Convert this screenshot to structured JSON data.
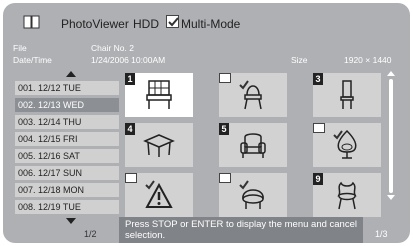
{
  "header": {
    "app_title": "PhotoViewer",
    "source": "HDD",
    "multi_mode_label": "Multi-Mode",
    "multi_mode_checked": true
  },
  "info": {
    "file_label": "File",
    "file_value": "Chair No. 2",
    "datetime_label": "Date/Time",
    "datetime_value": "1/24/2006 10:00AM",
    "size_label": "Size",
    "size_value": "1920 × 1440"
  },
  "dates": {
    "items": [
      {
        "label": "001. 12/12 TUE"
      },
      {
        "label": "002. 12/13 WED"
      },
      {
        "label": "003. 12/14 THU"
      },
      {
        "label": "004. 12/15 FRI"
      },
      {
        "label": "005. 12/16 SAT"
      },
      {
        "label": "006. 12/17 SUN"
      },
      {
        "label": "007. 12/18 MON"
      },
      {
        "label": "008. 12/19 TUE"
      }
    ],
    "selected_index": 1,
    "page": "1/2"
  },
  "thumbnails": {
    "items": [
      {
        "number": "1",
        "icon": "grid-chair-icon",
        "checked": false,
        "selected": true
      },
      {
        "number": "",
        "icon": "chair-icon",
        "checked": true,
        "selected": false
      },
      {
        "number": "3",
        "icon": "tall-chair-icon",
        "checked": false,
        "selected": false
      },
      {
        "number": "4",
        "icon": "table-icon",
        "checked": false,
        "selected": false
      },
      {
        "number": "5",
        "icon": "armchair-icon",
        "checked": false,
        "selected": false
      },
      {
        "number": "",
        "icon": "round-chair-icon",
        "checked": true,
        "selected": false
      },
      {
        "number": "",
        "icon": "warning-icon",
        "checked": true,
        "selected": false
      },
      {
        "number": "",
        "icon": "tub-chair-icon",
        "checked": true,
        "selected": false
      },
      {
        "number": "9",
        "icon": "ornate-chair-icon",
        "checked": false,
        "selected": false
      }
    ]
  },
  "footer": {
    "help_text": "Press STOP or ENTER to display the menu and cancel selection.",
    "page": "1/3"
  }
}
